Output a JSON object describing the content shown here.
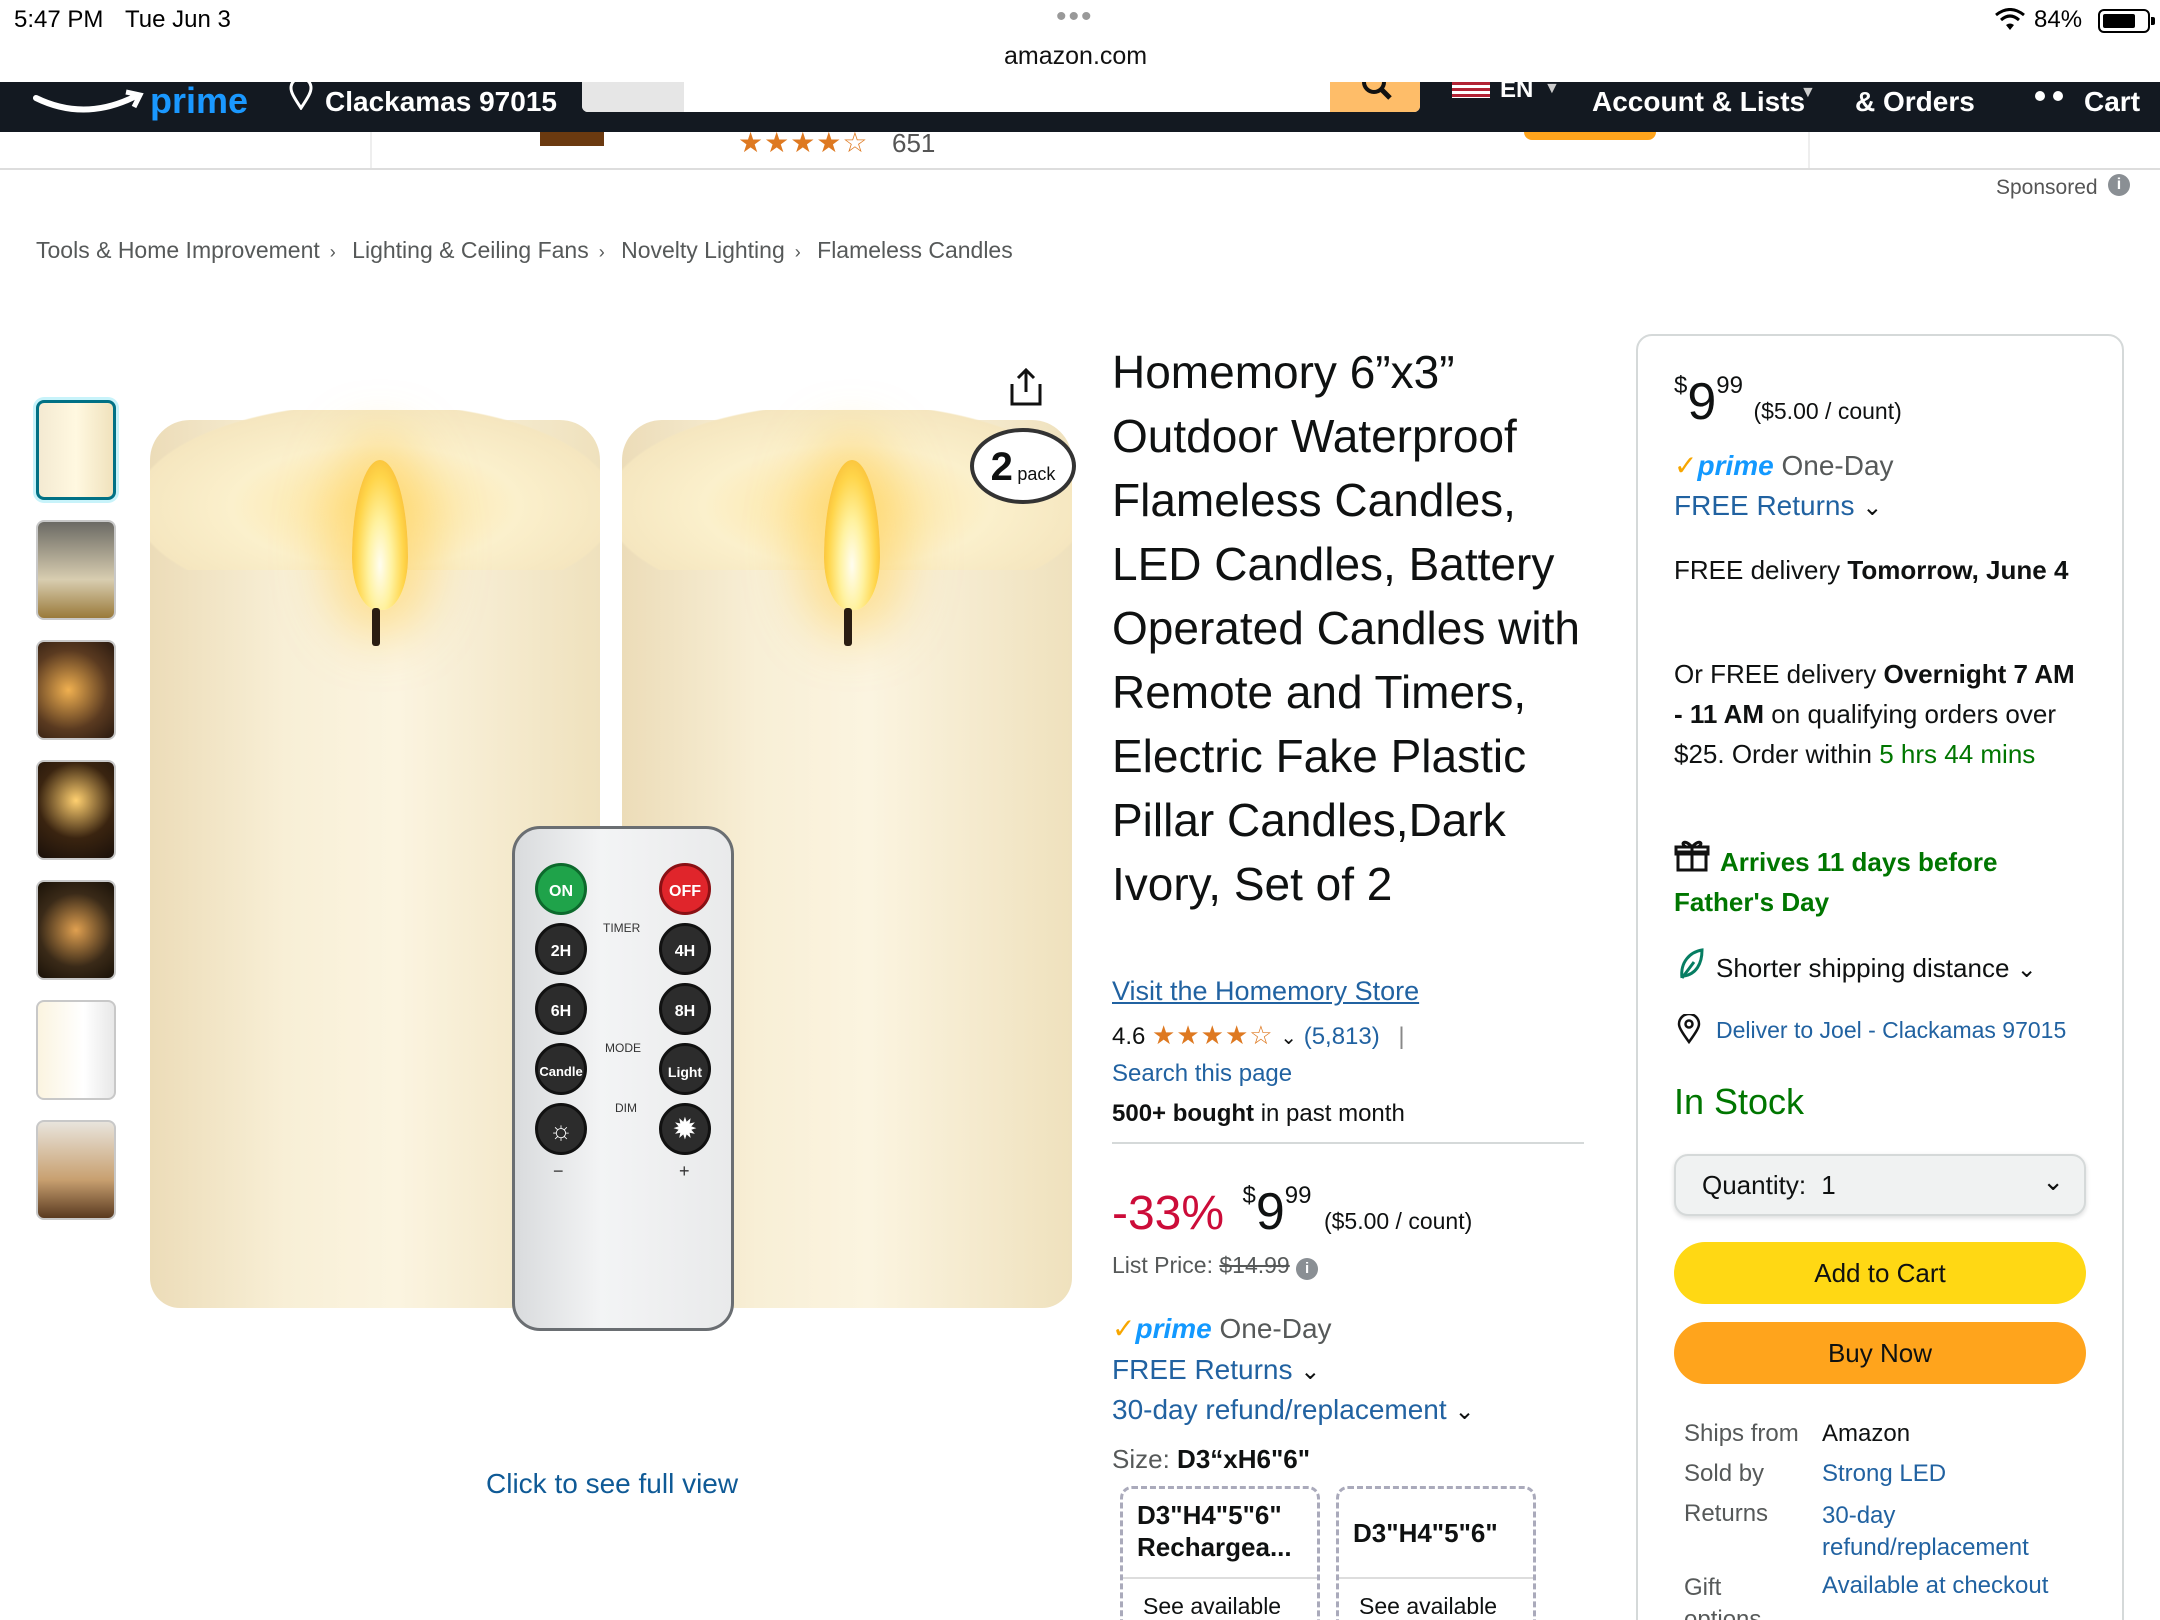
{
  "status_bar": {
    "time": "5:47 PM",
    "date": "Tue Jun 3",
    "url": "amazon.com",
    "battery": "84%",
    "battery_level": 0.84
  },
  "nav": {
    "logo_text": "prime",
    "location": "Clackamas 97015",
    "language": "EN",
    "account": "Account & Lists",
    "orders": "& Orders",
    "cart": "Cart"
  },
  "banner": {
    "rating_count": "651"
  },
  "sponsored": "Sponsored",
  "breadcrumb": [
    "Tools & Home Improvement",
    "Lighting & Ceiling Fans",
    "Novelty Lighting",
    "Flameless Candles"
  ],
  "image": {
    "pack_number": "2",
    "pack_text": "pack",
    "remote_labels": {
      "on": "ON",
      "off": "OFF",
      "timer": "TIMER",
      "h2": "2H",
      "h4": "4H",
      "h6": "6H",
      "h8": "8H",
      "mode": "MODE",
      "candle": "Candle",
      "light": "Light",
      "dim": "DIM",
      "minus": "−",
      "plus": "+"
    },
    "full_view": "Click to see full view"
  },
  "product": {
    "title": "Homemory 6”x3” Outdoor Waterproof Flameless Candles, LED Candles, Battery Operated Candles with Remote and Timers, Electric Fake Plastic Pillar Candles,Dark Ivory, Set of 2",
    "store_link": "Visit the Homemory Store",
    "rating": "4.6",
    "rating_value": 4.6,
    "review_count": "(5,813)",
    "search_page": "Search this page",
    "bought_bold": "500+ bought",
    "bought_rest": "in past month",
    "discount": "-33%",
    "price_symbol": "$",
    "price_whole": "9",
    "price_frac": "99",
    "unit_price": "($5.00 / count)",
    "list_price_label": "List Price:",
    "list_price": "$14.99",
    "prime_label": "prime",
    "prime_speed": "One-Day",
    "free_returns": "FREE Returns",
    "refund": "30-day refund/replacement",
    "size_label": "Size:",
    "size_value": "D3“xH6\"6\"",
    "size_options": [
      {
        "name": "D3\"H4\"5\"6\" Rechargea...",
        "avail": "See available"
      },
      {
        "name": "D3\"H4\"5\"6\"",
        "avail": "See available"
      }
    ]
  },
  "buybox": {
    "price_symbol": "$",
    "price_whole": "9",
    "price_frac": "99",
    "unit_price": "($5.00 / count)",
    "prime_label": "prime",
    "prime_speed": "One-Day",
    "free_returns": "FREE Returns",
    "delivery_prefix": "FREE delivery",
    "delivery_date": "Tomorrow, June 4",
    "fast_prefix": "Or FREE delivery",
    "fast_bold_1": "Overnight",
    "fast_bold_2": "7 AM - 11 AM",
    "fast_rest": "on qualifying orders over $25. Order within",
    "countdown": "5 hrs 44 mins",
    "gift_note": "Arrives 11 days before Father's Day",
    "shipping_note": "Shorter shipping distance",
    "deliver_to": "Deliver to Joel - Clackamas 97015",
    "stock": "In Stock",
    "quantity_label": "Quantity:",
    "quantity_value": "1",
    "add_to_cart": "Add to Cart",
    "buy_now": "Buy Now",
    "meta": [
      {
        "k": "Ships from",
        "v": "Amazon"
      },
      {
        "k": "Sold by",
        "v": "Strong LED"
      },
      {
        "k": "Returns",
        "v": "30-day refund/replacement"
      },
      {
        "k": "Gift options",
        "v": "Available at checkout"
      }
    ]
  },
  "colors": {
    "nav_bg": "#131921",
    "link": "#2162a1",
    "deal_red": "#cc0c39",
    "prime_blue": "#1399ff",
    "in_stock": "#007600",
    "add_cart": "#ffd814",
    "buy_now": "#ffa41c"
  }
}
